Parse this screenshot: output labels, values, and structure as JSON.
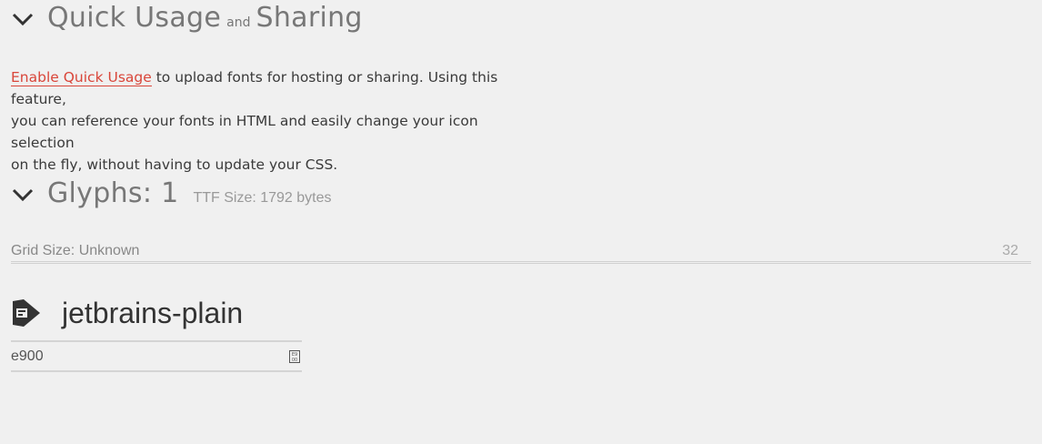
{
  "quick_usage": {
    "title_left": "Quick Usage",
    "title_mid": "and",
    "title_right": "Sharing",
    "enable_link": "Enable Quick Usage",
    "desc_line1_rest": " to upload fonts for hosting or sharing. Using this feature,",
    "desc_line2": "you can reference your fonts in HTML and easily change your icon selection",
    "desc_line3": "on the fly, without having to update your CSS."
  },
  "glyphs": {
    "title": "Glyphs: 1",
    "ttf_size": "TTF Size: 1792 bytes",
    "grid_label": "Grid Size: Unknown",
    "grid_value": "32"
  },
  "glyph_item": {
    "name": "jetbrains-plain",
    "icon": "jetbrains-glyph-icon",
    "code": "e900"
  },
  "colors": {
    "background": "#f0f0f0",
    "link": "#d9463a",
    "title": "#777777"
  }
}
